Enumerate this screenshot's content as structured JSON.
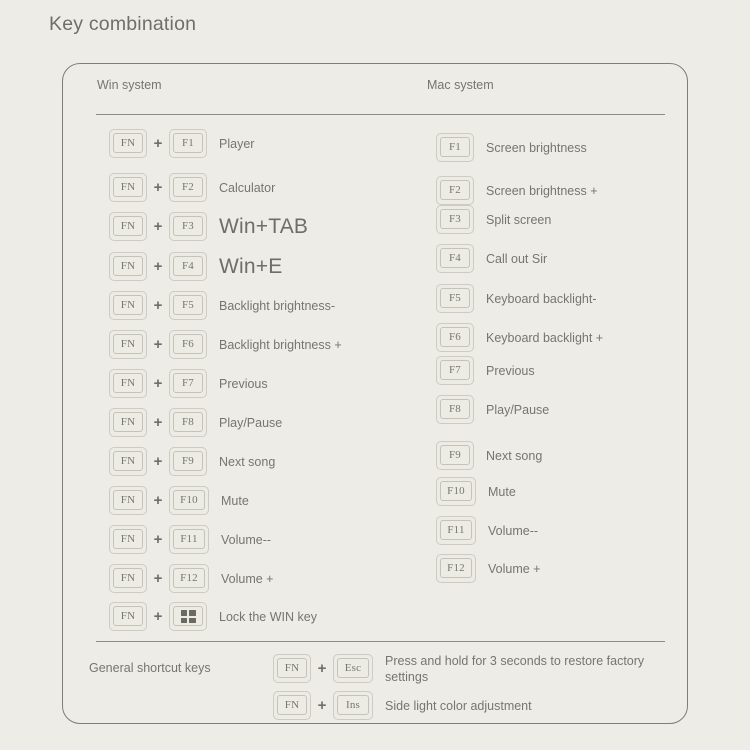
{
  "page_title": "Key combination",
  "card": {
    "columns": {
      "win_header": "Win system",
      "mac_header": "Mac system"
    },
    "win_rows": [
      {
        "modifier": "FN",
        "plus": "+",
        "key": "F1",
        "key_icon": "function-key-f1",
        "desc": "Player",
        "style": "normal"
      },
      {
        "modifier": "FN",
        "plus": "+",
        "key": "F2",
        "key_icon": "function-key-f2",
        "desc": "Calculator",
        "style": "normal"
      },
      {
        "modifier": "FN",
        "plus": "+",
        "key": "F3",
        "key_icon": "function-key-f3",
        "desc": "Win+TAB",
        "style": "big"
      },
      {
        "modifier": "FN",
        "plus": "+",
        "key": "F4",
        "key_icon": "function-key-f4",
        "desc": "Win+E",
        "style": "big"
      },
      {
        "modifier": "FN",
        "plus": "+",
        "key": "F5",
        "key_icon": "function-key-f5",
        "desc": "Backlight brightness-",
        "style": "normal"
      },
      {
        "modifier": "FN",
        "plus": "+",
        "key": "F6",
        "key_icon": "function-key-f6",
        "desc": "Backlight brightness +",
        "style": "normal"
      },
      {
        "modifier": "FN",
        "plus": "+",
        "key": "F7",
        "key_icon": "function-key-f7",
        "desc": "Previous",
        "style": "normal"
      },
      {
        "modifier": "FN",
        "plus": "+",
        "key": "F8",
        "key_icon": "function-key-f8",
        "desc": "Play/Pause",
        "style": "normal"
      },
      {
        "modifier": "FN",
        "plus": "+",
        "key": "F9",
        "key_icon": "function-key-f9",
        "desc": "Next song",
        "style": "normal"
      },
      {
        "modifier": "FN",
        "plus": "+",
        "key": "F10",
        "key_icon": "function-key-f10",
        "desc": "Mute",
        "style": "normal"
      },
      {
        "modifier": "FN",
        "plus": "+",
        "key": "F11",
        "key_icon": "function-key-f11",
        "desc": "Volume--",
        "style": "normal"
      },
      {
        "modifier": "FN",
        "plus": "+",
        "key": "F12",
        "key_icon": "function-key-f12",
        "desc": "Volume +",
        "style": "normal"
      },
      {
        "modifier": "FN",
        "plus": "+",
        "key": "",
        "key_icon": "windows-logo-icon",
        "desc": "Lock the WIN key",
        "style": "normal"
      }
    ],
    "mac_rows": [
      {
        "key": "F1",
        "key_icon": "function-key-f1",
        "desc": "Screen brightness"
      },
      {
        "key": "F2",
        "key_icon": "function-key-f2",
        "desc": "Screen brightness +"
      },
      {
        "key": "F3",
        "key_icon": "function-key-f3",
        "desc": "Split screen"
      },
      {
        "key": "F4",
        "key_icon": "function-key-f4",
        "desc": "Call out Sir"
      },
      {
        "key": "F5",
        "key_icon": "function-key-f5",
        "desc": "Keyboard backlight-"
      },
      {
        "key": "F6",
        "key_icon": "function-key-f6",
        "desc": "Keyboard backlight +"
      },
      {
        "key": "F7",
        "key_icon": "function-key-f7",
        "desc": "Previous"
      },
      {
        "key": "F8",
        "key_icon": "function-key-f8",
        "desc": "Play/Pause"
      },
      {
        "key": "F9",
        "key_icon": "function-key-f9",
        "desc": "Next song"
      },
      {
        "key": "F10",
        "key_icon": "function-key-f10",
        "desc": "Mute"
      },
      {
        "key": "F11",
        "key_icon": "function-key-f11",
        "desc": "Volume--"
      },
      {
        "key": "F12",
        "key_icon": "function-key-f12",
        "desc": "Volume +"
      }
    ],
    "general": {
      "label": "General shortcut keys",
      "rows": [
        {
          "modifier": "FN",
          "plus": "+",
          "key": "Esc",
          "desc": "Press and hold for 3 seconds to restore factory settings"
        },
        {
          "modifier": "FN",
          "plus": "+",
          "key": "Ins",
          "desc": "Side light color adjustment"
        }
      ]
    }
  },
  "colors": {
    "background": "#eeece6",
    "card_border": "#7e7d76",
    "text": "#76756f",
    "divider": "#8d8c85",
    "keycap_border": "#cdcbc3"
  }
}
